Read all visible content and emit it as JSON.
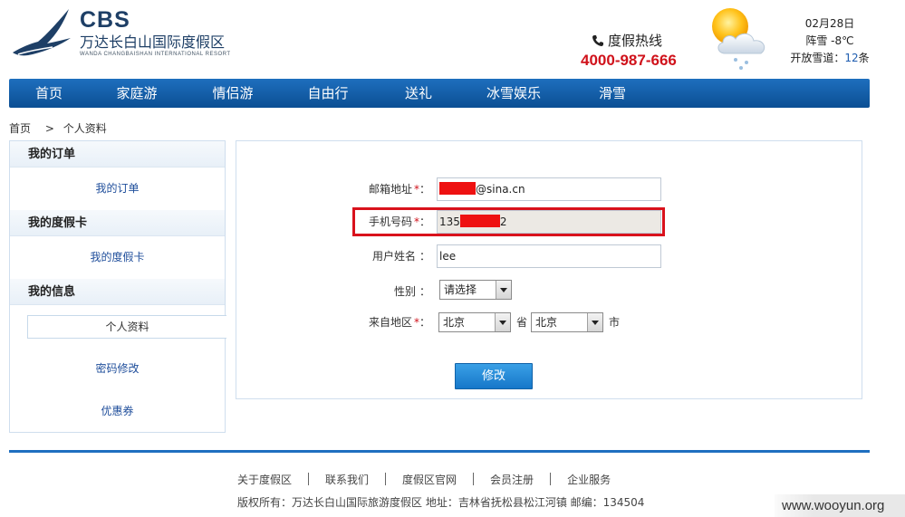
{
  "header": {
    "brand": "CBS",
    "resort_name_cn": "万达长白山国际度假区",
    "resort_name_en": "WANDA CHANGBAISHAN INTERNATIONAL RESORT",
    "hotline_label": "度假热线",
    "hotline_number": "4000-987-666",
    "weather": {
      "date": "02月28日",
      "condition": "阵雪 -8℃",
      "trails_label": "开放雪道：",
      "trails_count": "12",
      "trails_unit": "条"
    }
  },
  "nav": {
    "items": [
      "首页",
      "家庭游",
      "情侣游",
      "自由行",
      "送礼",
      "冰雪娱乐",
      "滑雪"
    ]
  },
  "breadcrumb": {
    "home": "首页",
    "separator": ">",
    "current": "个人资料"
  },
  "sidebar": {
    "sections": [
      {
        "title": "我的订单",
        "items": [
          "我的订单"
        ]
      },
      {
        "title": "我的度假卡",
        "items": [
          "我的度假卡"
        ]
      },
      {
        "title": "我的信息",
        "items": [
          "个人资料",
          "密码修改",
          "优惠券"
        ]
      }
    ],
    "active_item": "个人资料"
  },
  "form": {
    "email": {
      "label": "邮箱地址",
      "required": "*",
      "colon": "：",
      "value_suffix": "@sina.cn"
    },
    "phone": {
      "label": "手机号码",
      "required": "*",
      "colon": "：",
      "value_prefix": "135",
      "value_suffix": "2"
    },
    "username": {
      "label": "用户姓名",
      "colon": "：",
      "value": "lee"
    },
    "gender": {
      "label": "性别",
      "colon": "：",
      "selected": "请选择"
    },
    "region": {
      "label": "来自地区",
      "required": "*",
      "colon": "：",
      "province": "北京",
      "province_unit": "省",
      "city": "北京",
      "city_unit": "市"
    },
    "submit_label": "修改"
  },
  "footer": {
    "links": [
      "关于度假区",
      "联系我们",
      "度假区官网",
      "会员注册",
      "企业服务"
    ],
    "copyright": "版权所有：万达长白山国际旅游度假区 地址：吉林省抚松县松江河镇 邮编：134504"
  },
  "watermark": "www.wooyun.org",
  "colors": {
    "nav_blue": "#0f5aa5",
    "hotline_red": "#d0121b",
    "highlight_red": "#d9121c",
    "link_blue": "#1f4e9b"
  }
}
